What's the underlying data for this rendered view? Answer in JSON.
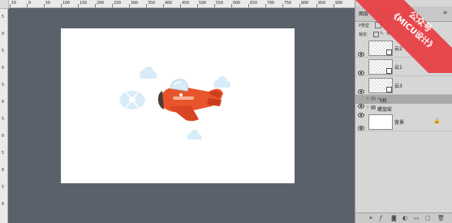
{
  "ruler": {
    "top_labels": [
      "50",
      "0",
      "50",
      "100",
      "150",
      "200",
      "250",
      "300",
      "350",
      "400",
      "450",
      "500",
      "550",
      "600",
      "650",
      "700",
      "750",
      "800",
      "850",
      "900"
    ],
    "left_labels": [
      "5",
      "0",
      "5",
      "0",
      "5",
      "0",
      "5",
      "0",
      "5",
      "0",
      "5",
      "0"
    ]
  },
  "panel": {
    "tab_left": "图层",
    "tab_right": "≡",
    "filter_label": "P类型",
    "lock_label": "锁定:",
    "layers": [
      {
        "name": "云2",
        "type": "shape"
      },
      {
        "name": "云1",
        "type": "shape"
      },
      {
        "name": "云3",
        "type": "shape"
      },
      {
        "name": "飞机",
        "type": "group",
        "selected": true
      },
      {
        "name": "螺旋桨",
        "type": "group"
      },
      {
        "name": "背景",
        "type": "background",
        "locked": true
      }
    ],
    "footer_icons": [
      "link-icon",
      "fx-icon",
      "mask-icon",
      "adjustment-icon",
      "folder-icon",
      "new-layer-icon",
      "trash-icon"
    ]
  },
  "watermark": {
    "line1": "公众号",
    "line2": "《MICU设计》",
    "color": "#e8383d"
  },
  "colors": {
    "workspace": "#5b616b",
    "plane_body": "#e8542b",
    "cloud": "#d8ecf8",
    "selected_layer": "#a8a8a8"
  }
}
